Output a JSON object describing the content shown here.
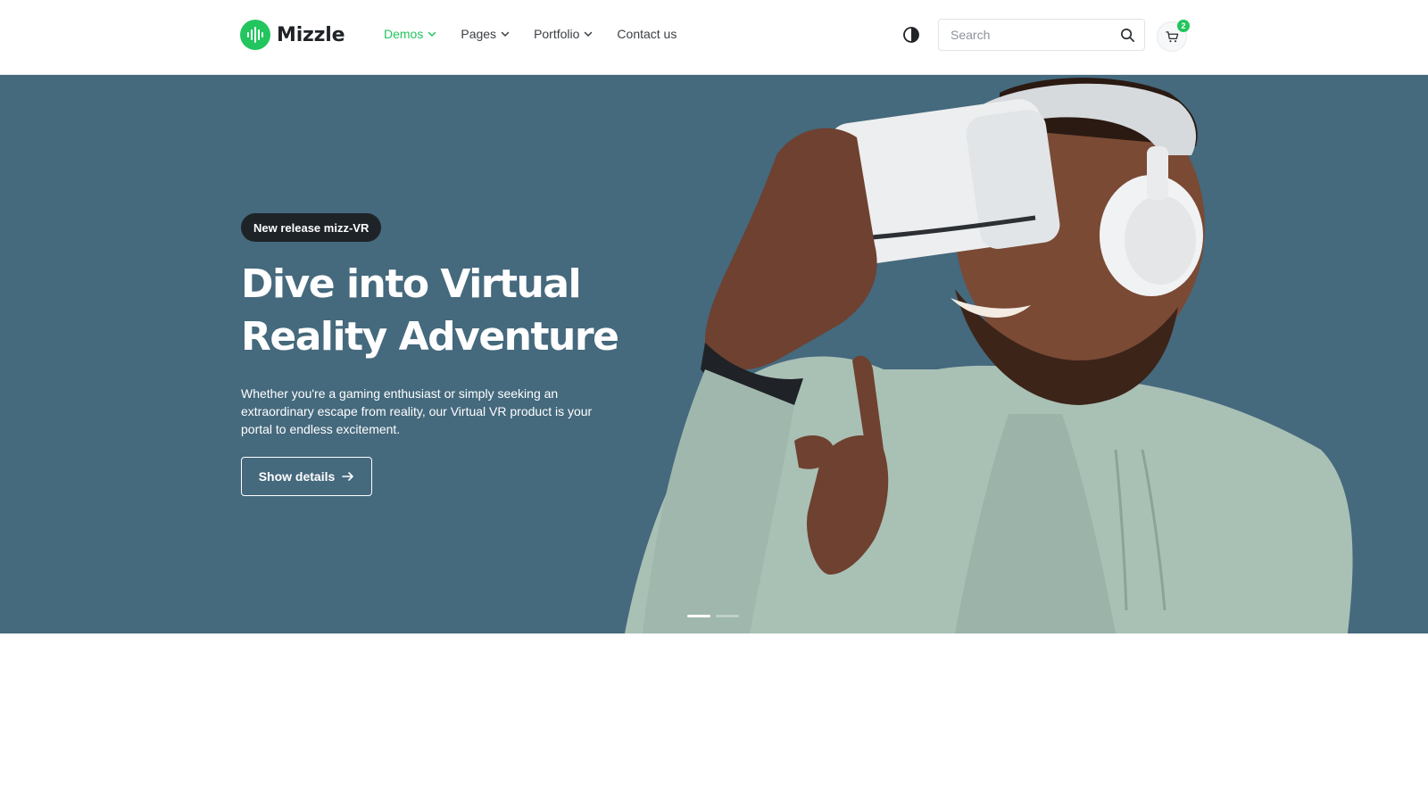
{
  "brand": {
    "name": "Mizzle",
    "accent": "#22c55e"
  },
  "nav": {
    "items": [
      {
        "label": "Demos",
        "has_dropdown": true,
        "active": true
      },
      {
        "label": "Pages",
        "has_dropdown": true,
        "active": false
      },
      {
        "label": "Portfolio",
        "has_dropdown": true,
        "active": false
      },
      {
        "label": "Contact us",
        "has_dropdown": false,
        "active": false
      }
    ]
  },
  "header": {
    "theme_toggle_icon": "contrast-icon",
    "search": {
      "placeholder": "Search",
      "value": ""
    },
    "cart": {
      "count": "2",
      "icon": "cart-icon"
    }
  },
  "hero": {
    "background": "#45697d",
    "badge": "New release mizz-VR",
    "headline": "Dive into Virtual Reality Adventure",
    "description": "Whether you're a gaming enthusiast or simply seeking an extraordinary escape from reality, our Virtual VR product is your portal to endless excitement.",
    "cta_label": "Show details",
    "cta_icon": "arrow-right-icon",
    "slides_total": 2,
    "slide_active": 1
  }
}
